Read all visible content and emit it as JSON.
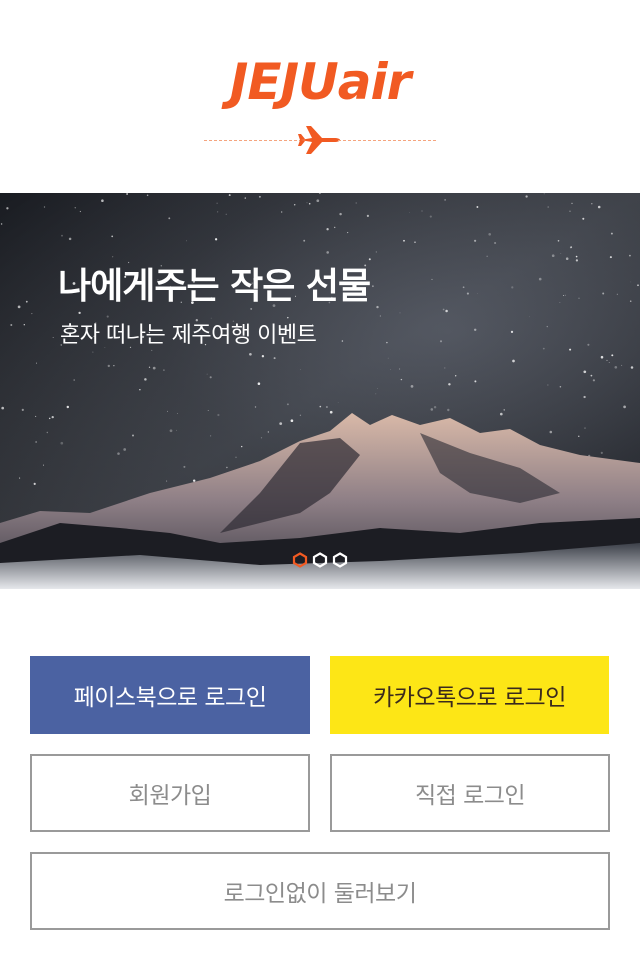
{
  "brand": {
    "logo_text": "JEJUair",
    "accent_color": "#f15a22",
    "plane_icon": "airplane-icon"
  },
  "banner": {
    "title": "나에게주는 작은 선물",
    "subtitle": "혼자 떠나는 제주여행 이벤트",
    "slide_count": 3,
    "active_slide": 1
  },
  "buttons": {
    "facebook_login": "페이스북으로 로그인",
    "kakao_login": "카카오톡으로 로그인",
    "signup": "회원가입",
    "direct_login": "직접 로그인",
    "browse_without_login": "로그인없이 둘러보기"
  },
  "colors": {
    "facebook": "#4b62a2",
    "kakao": "#fde616",
    "outline_border": "#9a9a9a",
    "outline_text": "#8c8c8c",
    "active_dot": "#f15a22",
    "inactive_dot": "#ffffff"
  }
}
